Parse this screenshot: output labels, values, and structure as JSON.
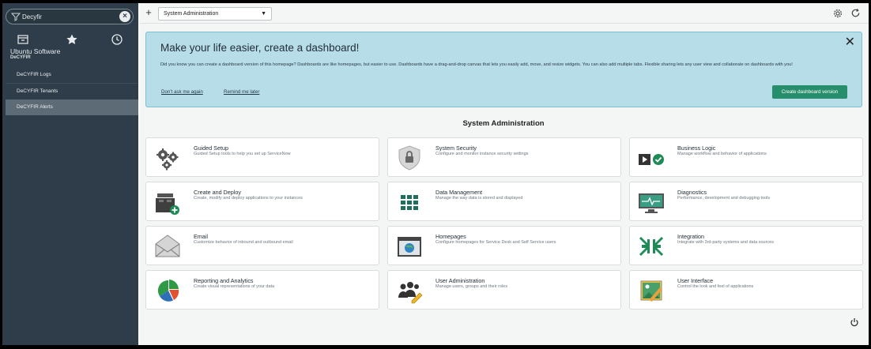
{
  "sidebar": {
    "filter_value": "Decyfir",
    "ubuntu_label": "Ubuntu Software",
    "app_label": "DeCYFIR",
    "items": [
      {
        "label": "DeCYFIR Logs"
      },
      {
        "label": "DeCYFIR Tenants"
      },
      {
        "label": "DeCYFIR Alerts"
      }
    ]
  },
  "topbar": {
    "page_select": "System Administration"
  },
  "banner": {
    "title": "Make your life easier, create a dashboard!",
    "text": "Did you know you can create a dashboard version of this homepage? Dashboards are like homepages, but easier to use. Dashboards have a drag-and-drop canvas that lets you easily add, move, and resize widgets. You can also add multiple tabs. Flexible sharing lets any user view and collaborate on dashboards with you!",
    "dont_ask": "Don't ask me again",
    "remind_later": "Remind me later",
    "create_button": "Create dashboard version"
  },
  "section_title": "System Administration",
  "cards": [
    {
      "title": "Guided Setup",
      "desc": "Guided Setup tools to help you set up ServiceNow",
      "icon": "gears-icon"
    },
    {
      "title": "System Security",
      "desc": "Configure and monitor instance security settings",
      "icon": "shield-lock-icon"
    },
    {
      "title": "Business Logic",
      "desc": "Manage workflow and behavior of applications",
      "icon": "play-check-icon"
    },
    {
      "title": "Create and Deploy",
      "desc": "Create, modify and deploy applications to your instances",
      "icon": "blocks-add-icon"
    },
    {
      "title": "Data Management",
      "desc": "Manage the way data is stored and displayed",
      "icon": "grid-icon"
    },
    {
      "title": "Diagnostics",
      "desc": "Performance, development and debugging tools",
      "icon": "monitor-pulse-icon"
    },
    {
      "title": "Email",
      "desc": "Customize behavior of inbound and outbound email",
      "icon": "envelope-icon"
    },
    {
      "title": "Homepages",
      "desc": "Configure homepages for Service Desk and Self Service users",
      "icon": "browser-globe-icon"
    },
    {
      "title": "Integration",
      "desc": "Integrate with 3rd-party systems and data sources",
      "icon": "arrows-in-icon"
    },
    {
      "title": "Reporting and Analytics",
      "desc": "Create visual representations of your data",
      "icon": "pie-chart-icon"
    },
    {
      "title": "User Administration",
      "desc": "Manage users, groups and their roles",
      "icon": "users-edit-icon"
    },
    {
      "title": "User Interface",
      "desc": "Control the look and feel of applications",
      "icon": "image-brush-icon"
    }
  ],
  "colors": {
    "sidebar_bg": "#2e3d49",
    "banner_bg": "#b7dde9",
    "accent_green": "#278e6c"
  }
}
